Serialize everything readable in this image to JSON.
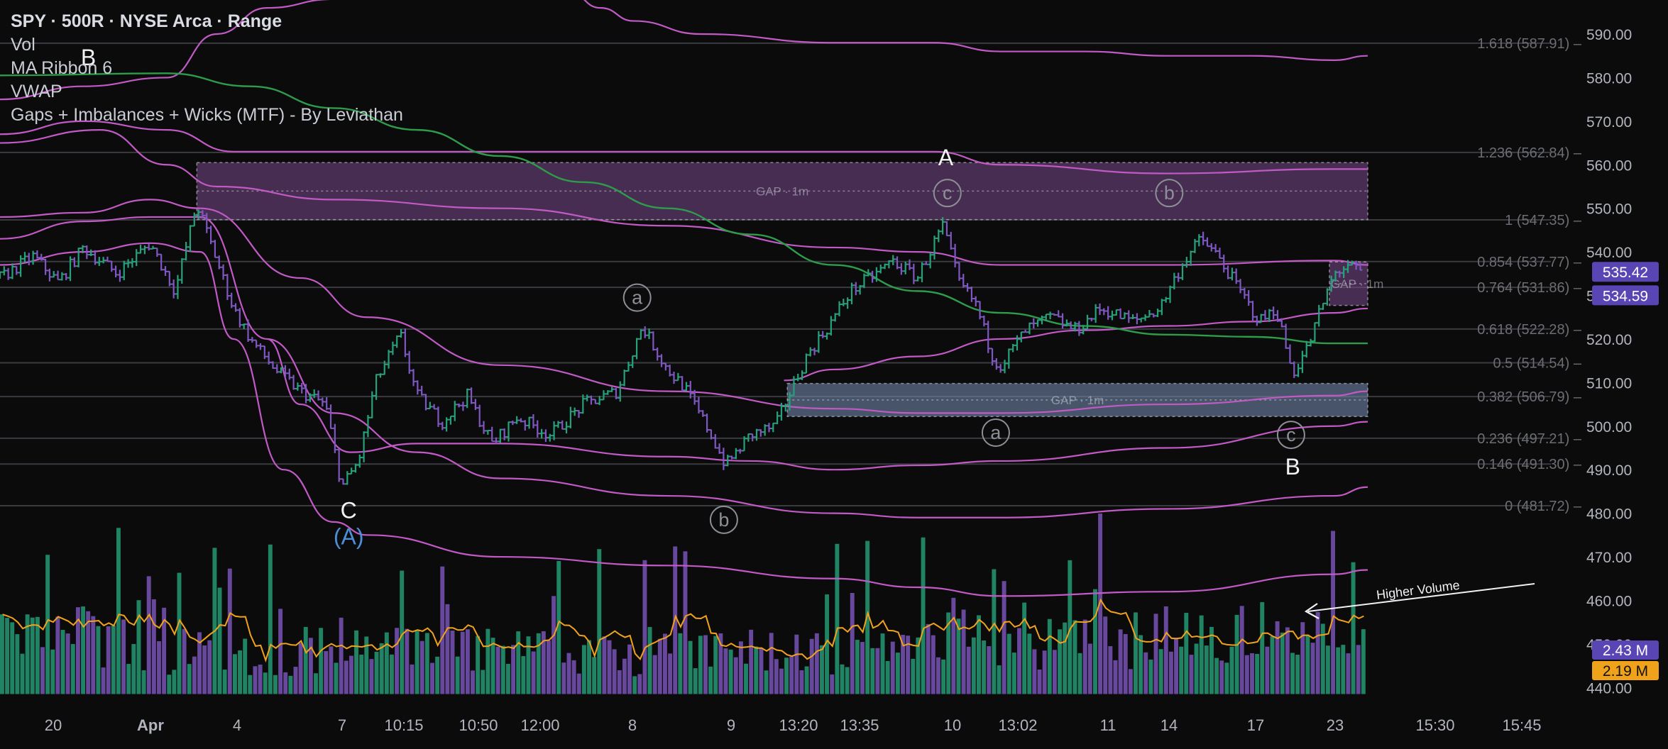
{
  "legend": {
    "symbol": "SPY",
    "interval": "500R",
    "exchange": "NYSE Arca",
    "chart_style": "Range",
    "separator": " · ",
    "indicators": [
      "Vol",
      "MA Ribbon 6",
      "VWAP",
      "Gaps + Imbalances + Wicks (MTF) - By Leviathan"
    ]
  },
  "colors": {
    "background": "#0b0b0c",
    "up": "#26a17b",
    "down": "#7e57c2",
    "vwap_band": "#c25ac5",
    "ma": "#2e9c4a",
    "volume_ma": "#f0a21b",
    "gap_upper": "#7a4a8a",
    "gap_lower": "#6f86a8",
    "fib_line": "#3a3b40",
    "axis_text": "#b2b5be",
    "fib_text": "#6c6e74",
    "wave_circle": "#8c8f96",
    "price_last": "#5a45b5",
    "volume_last": "#5a45b5",
    "volume_ma_last": "#f0a21b"
  },
  "chart_data": {
    "type": "candlestick",
    "price_axis": {
      "ticks": [
        590,
        580,
        570,
        560,
        550,
        540,
        530,
        520,
        510,
        500,
        490,
        480,
        470,
        460,
        450,
        440
      ],
      "tick_labels": [
        "590.00",
        "580.00",
        "570.00",
        "560.00",
        "550.00",
        "540.00",
        "530.00",
        "520.00",
        "510.00",
        "500.00",
        "490.00",
        "480.00",
        "470.00",
        "460.00",
        "450.00",
        "440.00"
      ]
    },
    "time_axis": {
      "labels": [
        "20",
        "Apr",
        "4",
        "7",
        "10:15",
        "10:50",
        "12:00",
        "8",
        "9",
        "13:20",
        "13:35",
        "10",
        "13:02",
        "11",
        "14",
        "17",
        "23",
        "15:30",
        "15:45"
      ],
      "bold": [
        "Apr"
      ]
    },
    "fib_levels": [
      {
        "ratio": "1.618",
        "price": 587.91,
        "label": "1.618 (587.91)"
      },
      {
        "ratio": "1.236",
        "price": 562.84,
        "label": "1.236 (562.84)"
      },
      {
        "ratio": "1",
        "price": 547.35,
        "label": "1 (547.35)"
      },
      {
        "ratio": "0.854",
        "price": 537.77,
        "label": "0.854 (537.77)"
      },
      {
        "ratio": "0.764",
        "price": 531.86,
        "label": "0.764 (531.86)"
      },
      {
        "ratio": "0.618",
        "price": 522.28,
        "label": "0.618 (522.28)"
      },
      {
        "ratio": "0.5",
        "price": 514.54,
        "label": "0.5 (514.54)"
      },
      {
        "ratio": "0.382",
        "price": 506.79,
        "label": "0.382 (506.79)"
      },
      {
        "ratio": "0.236",
        "price": 497.21,
        "label": "0.236 (497.21)"
      },
      {
        "ratio": "0.146",
        "price": 491.3,
        "label": "0.146 (491.30)"
      },
      {
        "ratio": "0",
        "price": 481.72,
        "label": "0 (481.72)"
      }
    ],
    "gaps": [
      {
        "label": "GAP · 1m",
        "top": 560.5,
        "bottom": 547.4,
        "x_start": 0.118,
        "x_end": 0.82,
        "kind": "upper"
      },
      {
        "label": "GAP · 1m",
        "top": 509.8,
        "bottom": 502.2,
        "x_start": 0.472,
        "x_end": 0.82,
        "kind": "lower"
      },
      {
        "label": "GAP · 1m",
        "top": 537.7,
        "bottom": 527.7,
        "x_start": 0.797,
        "x_end": 0.82,
        "kind": "upper-small"
      }
    ],
    "price_waypoints": [
      [
        0.0,
        534
      ],
      [
        0.02,
        539
      ],
      [
        0.035,
        533
      ],
      [
        0.05,
        541
      ],
      [
        0.07,
        535
      ],
      [
        0.09,
        542
      ],
      [
        0.105,
        531
      ],
      [
        0.118,
        551
      ],
      [
        0.13,
        538
      ],
      [
        0.14,
        527
      ],
      [
        0.15,
        520
      ],
      [
        0.165,
        513
      ],
      [
        0.18,
        508
      ],
      [
        0.195,
        505
      ],
      [
        0.205,
        486
      ],
      [
        0.215,
        492
      ],
      [
        0.225,
        510
      ],
      [
        0.24,
        521
      ],
      [
        0.25,
        507
      ],
      [
        0.265,
        501
      ],
      [
        0.28,
        507
      ],
      [
        0.295,
        496
      ],
      [
        0.31,
        502
      ],
      [
        0.33,
        498
      ],
      [
        0.35,
        505
      ],
      [
        0.37,
        508
      ],
      [
        0.385,
        523
      ],
      [
        0.4,
        513
      ],
      [
        0.41,
        509
      ],
      [
        0.425,
        499
      ],
      [
        0.435,
        491
      ],
      [
        0.45,
        498
      ],
      [
        0.465,
        500
      ],
      [
        0.475,
        509
      ],
      [
        0.485,
        517
      ],
      [
        0.495,
        522
      ],
      [
        0.51,
        531
      ],
      [
        0.525,
        535
      ],
      [
        0.535,
        538
      ],
      [
        0.55,
        534
      ],
      [
        0.565,
        546
      ],
      [
        0.575,
        533
      ],
      [
        0.585,
        528
      ],
      [
        0.595,
        516
      ],
      [
        0.6,
        514
      ],
      [
        0.615,
        522
      ],
      [
        0.63,
        525
      ],
      [
        0.645,
        522
      ],
      [
        0.66,
        527
      ],
      [
        0.68,
        524
      ],
      [
        0.695,
        527
      ],
      [
        0.71,
        538
      ],
      [
        0.72,
        543
      ],
      [
        0.73,
        539
      ],
      [
        0.74,
        533
      ],
      [
        0.755,
        524
      ],
      [
        0.765,
        527
      ],
      [
        0.775,
        512
      ],
      [
        0.785,
        519
      ],
      [
        0.79,
        525
      ],
      [
        0.8,
        535
      ],
      [
        0.808,
        537
      ],
      [
        0.818,
        534.6
      ]
    ],
    "ma_waypoints": [
      [
        0.0,
        580.5
      ],
      [
        0.1,
        581
      ],
      [
        0.15,
        578
      ],
      [
        0.2,
        573
      ],
      [
        0.25,
        568
      ],
      [
        0.3,
        562
      ],
      [
        0.35,
        556
      ],
      [
        0.4,
        550
      ],
      [
        0.45,
        544
      ],
      [
        0.5,
        537
      ],
      [
        0.55,
        531
      ],
      [
        0.6,
        526
      ],
      [
        0.65,
        523
      ],
      [
        0.7,
        521
      ],
      [
        0.75,
        520.5
      ],
      [
        0.8,
        519
      ],
      [
        0.82,
        519
      ]
    ],
    "vwap_bands": [
      {
        "name": "band_top",
        "points": [
          [
            0.0,
            575
          ],
          [
            0.05,
            578
          ],
          [
            0.1,
            580
          ],
          [
            0.13,
            590
          ],
          [
            0.16,
            596
          ],
          [
            0.2,
            598
          ],
          [
            0.3,
            600
          ],
          [
            0.34,
            600
          ],
          [
            0.36,
            596
          ],
          [
            0.38,
            593
          ],
          [
            0.42,
            590
          ],
          [
            0.5,
            588
          ],
          [
            0.56,
            588
          ],
          [
            0.6,
            586
          ],
          [
            0.65,
            586
          ],
          [
            0.7,
            585
          ],
          [
            0.75,
            585
          ],
          [
            0.8,
            584
          ],
          [
            0.82,
            585
          ]
        ]
      },
      {
        "name": "band_2",
        "points": [
          [
            0.0,
            567
          ],
          [
            0.05,
            570
          ],
          [
            0.1,
            568
          ],
          [
            0.14,
            563
          ],
          [
            0.2,
            563
          ],
          [
            0.3,
            563
          ],
          [
            0.4,
            563
          ],
          [
            0.5,
            563
          ],
          [
            0.56,
            563
          ],
          [
            0.6,
            560
          ],
          [
            0.7,
            558
          ],
          [
            0.8,
            559
          ],
          [
            0.82,
            559
          ]
        ]
      },
      {
        "name": "band_3",
        "points": [
          [
            0.0,
            565
          ],
          [
            0.06,
            568
          ],
          [
            0.1,
            560
          ],
          [
            0.13,
            555
          ],
          [
            0.2,
            552
          ],
          [
            0.3,
            550
          ],
          [
            0.4,
            546
          ],
          [
            0.5,
            541
          ],
          [
            0.55,
            540
          ],
          [
            0.6,
            537
          ],
          [
            0.7,
            537
          ],
          [
            0.8,
            538
          ],
          [
            0.82,
            537
          ]
        ]
      },
      {
        "name": "band_4",
        "points": [
          [
            0.0,
            548
          ],
          [
            0.05,
            549
          ],
          [
            0.09,
            552
          ],
          [
            0.12,
            550
          ],
          [
            0.18,
            534
          ],
          [
            0.22,
            525
          ],
          [
            0.3,
            514
          ],
          [
            0.4,
            508
          ],
          [
            0.5,
            504
          ],
          [
            0.55,
            503
          ],
          [
            0.6,
            503
          ],
          [
            0.7,
            505
          ],
          [
            0.8,
            507
          ],
          [
            0.82,
            508
          ]
        ]
      },
      {
        "name": "band_5",
        "points": [
          [
            0.0,
            543
          ],
          [
            0.05,
            547
          ],
          [
            0.09,
            548
          ],
          [
            0.12,
            548
          ],
          [
            0.16,
            520
          ],
          [
            0.2,
            503
          ],
          [
            0.25,
            494
          ],
          [
            0.3,
            488
          ],
          [
            0.4,
            484
          ],
          [
            0.5,
            480
          ],
          [
            0.55,
            479
          ],
          [
            0.6,
            479
          ],
          [
            0.7,
            481
          ],
          [
            0.8,
            484
          ],
          [
            0.82,
            486
          ]
        ]
      },
      {
        "name": "band_6",
        "points": [
          [
            0.0,
            537
          ],
          [
            0.05,
            540
          ],
          [
            0.09,
            542
          ],
          [
            0.12,
            540
          ],
          [
            0.14,
            520
          ],
          [
            0.17,
            490
          ],
          [
            0.2,
            478
          ],
          [
            0.22,
            475
          ],
          [
            0.3,
            470
          ],
          [
            0.4,
            468
          ],
          [
            0.5,
            465
          ],
          [
            0.55,
            463
          ],
          [
            0.6,
            461
          ],
          [
            0.7,
            462
          ],
          [
            0.8,
            466
          ],
          [
            0.82,
            467
          ]
        ]
      },
      {
        "name": "band_inner",
        "points": [
          [
            0.47,
            510.5
          ],
          [
            0.5,
            513
          ],
          [
            0.55,
            516
          ],
          [
            0.6,
            520
          ],
          [
            0.65,
            522
          ],
          [
            0.7,
            523
          ],
          [
            0.75,
            524
          ],
          [
            0.8,
            526
          ],
          [
            0.82,
            527
          ]
        ]
      },
      {
        "name": "band_lower_1",
        "points": [
          [
            0.16,
            520
          ],
          [
            0.18,
            505
          ],
          [
            0.21,
            494
          ],
          [
            0.25,
            496
          ],
          [
            0.3,
            496
          ],
          [
            0.4,
            493
          ],
          [
            0.45,
            492
          ],
          [
            0.5,
            490
          ],
          [
            0.55,
            491
          ],
          [
            0.6,
            492
          ],
          [
            0.7,
            495
          ],
          [
            0.8,
            500
          ],
          [
            0.82,
            501
          ]
        ]
      }
    ],
    "volume": {
      "ma_label": "2.19 M",
      "last_label": "2.43 M",
      "axis_ticks": [
        440,
        450,
        460
      ],
      "seed_note": ""
    },
    "price_last_labels": [
      "535.42",
      "534.59"
    ],
    "wave_labels": [
      {
        "text": "B",
        "x": 0.053,
        "price": 584.5,
        "style": "plain"
      },
      {
        "text": "A",
        "x": 0.567,
        "price": 561.5,
        "style": "plain"
      },
      {
        "text": "C",
        "x": 0.209,
        "price": 480.5,
        "style": "plain"
      },
      {
        "text": "(A)",
        "x": 0.209,
        "price": 474.5,
        "style": "blue"
      },
      {
        "text": "B",
        "x": 0.775,
        "price": 490.5,
        "style": "plain"
      },
      {
        "text": "a",
        "x": 0.382,
        "price": 529.5,
        "style": "circle"
      },
      {
        "text": "c",
        "x": 0.568,
        "price": 553.5,
        "style": "circle"
      },
      {
        "text": "b",
        "x": 0.701,
        "price": 553.5,
        "style": "circle"
      },
      {
        "text": "a",
        "x": 0.597,
        "price": 498.5,
        "style": "circle"
      },
      {
        "text": "c",
        "x": 0.774,
        "price": 498.0,
        "style": "circle"
      },
      {
        "text": "b",
        "x": 0.434,
        "price": 478.5,
        "style": "circle"
      }
    ],
    "annotation": {
      "text": "Higher Volume"
    }
  }
}
